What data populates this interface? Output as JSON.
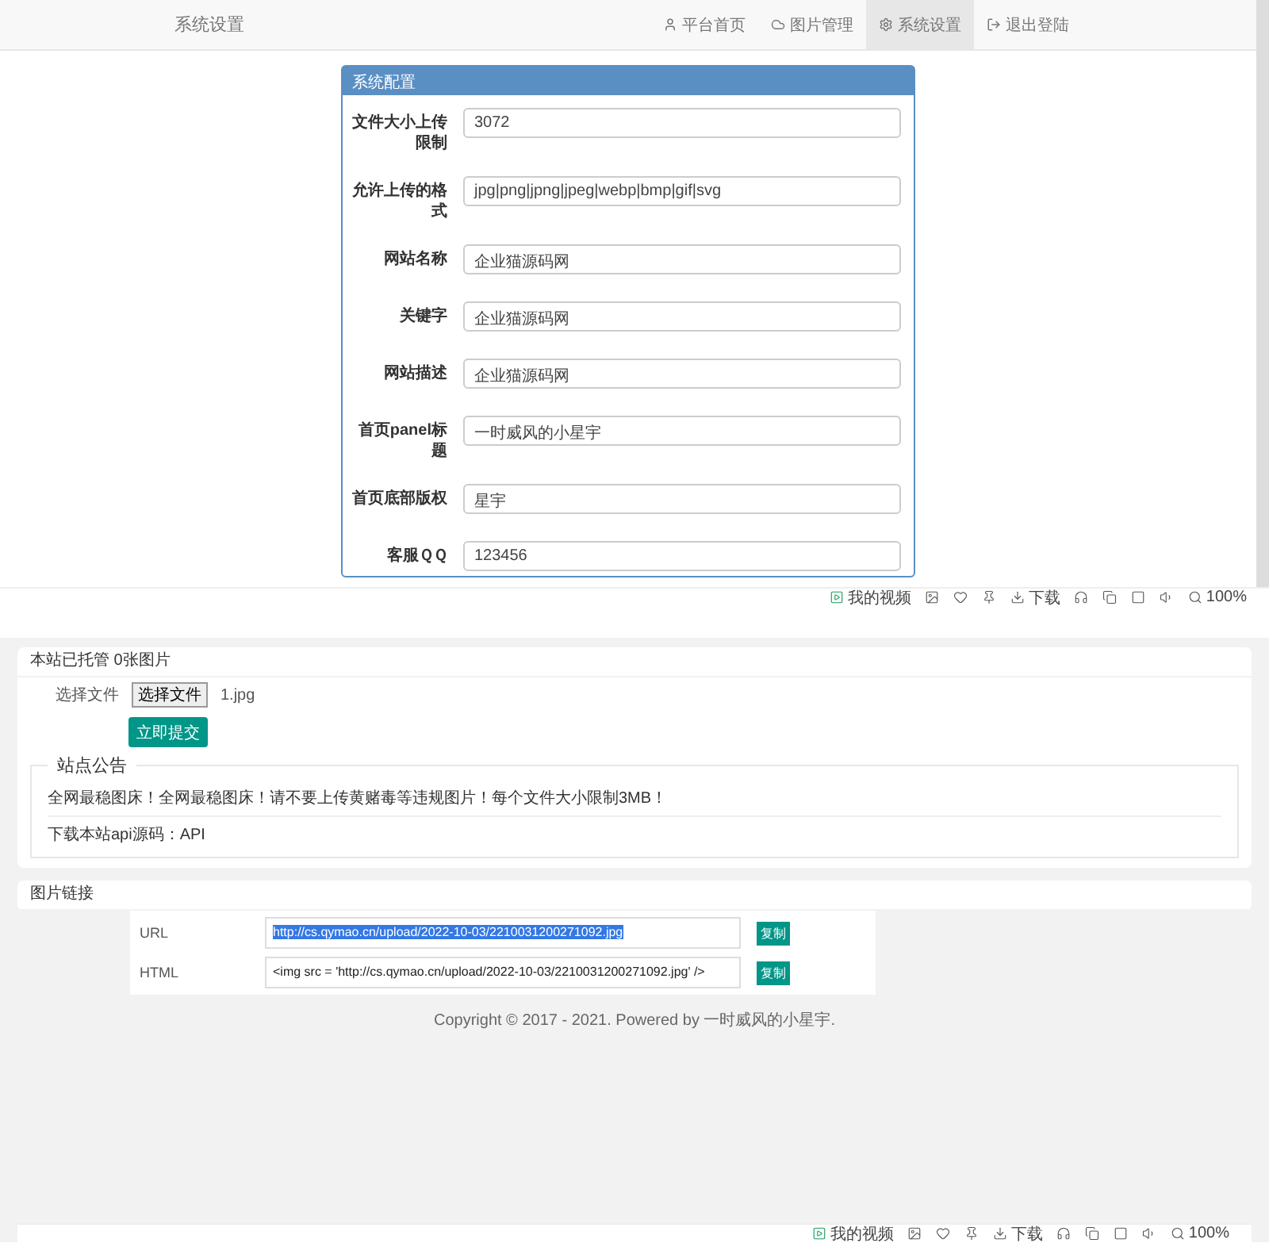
{
  "top_window": {
    "navbar": {
      "title": "系统设置",
      "items": [
        {
          "label": "平台首页",
          "selected": false
        },
        {
          "label": "图片管理",
          "selected": false
        },
        {
          "label": "系统设置",
          "selected": true
        },
        {
          "label": "退出登陆",
          "selected": false
        }
      ]
    },
    "panel": {
      "title": "系统配置",
      "fields": [
        {
          "label": "文件大小上传限制",
          "value": "3072"
        },
        {
          "label": "允许上传的格式",
          "value": "jpg|png|jpng|jpeg|webp|bmp|gif|svg"
        },
        {
          "label": "网站名称",
          "value": "企业猫源码网"
        },
        {
          "label": "关键字",
          "value": "企业猫源码网"
        },
        {
          "label": "网站描述",
          "value": "企业猫源码网"
        },
        {
          "label": "首页panel标题",
          "value": "一时威风的小星宇"
        },
        {
          "label": "首页底部版权",
          "value": "星宇"
        },
        {
          "label": "客服ＱＱ",
          "value": "123456"
        }
      ]
    },
    "status_bar": {
      "labels": [
        "我的视频",
        "下载",
        "100%"
      ]
    }
  },
  "bottom_window": {
    "upload_card": {
      "title": "本站已托管 0张图片",
      "file_label": "选择文件",
      "file_button": "选择文件",
      "file_name": "1.jpg",
      "submit": "立即提交",
      "notice": {
        "legend": "站点公告",
        "lines": [
          "全网最稳图床！全网最稳图床！请不要上传黄赌毒等违规图片！每个文件大小限制3MB！",
          "下载本站api源码：API"
        ]
      }
    },
    "links_card": {
      "title": "图片链接",
      "rows": [
        {
          "label": "URL",
          "value": "http://cs.qymao.cn/upload/2022-10-03/2210031200271092.jpg",
          "highlighted": true,
          "button": "复制"
        },
        {
          "label": "HTML",
          "value": "<img src = 'http://cs.qymao.cn/upload/2022-10-03/2210031200271092.jpg' />",
          "highlighted": false,
          "button": "复制"
        }
      ]
    },
    "footer": "Copyright © 2017 - 2021. Powered by 一时威风的小星宇.",
    "status_bar": {
      "labels": [
        "我的视频",
        "下载",
        "100%"
      ]
    }
  }
}
